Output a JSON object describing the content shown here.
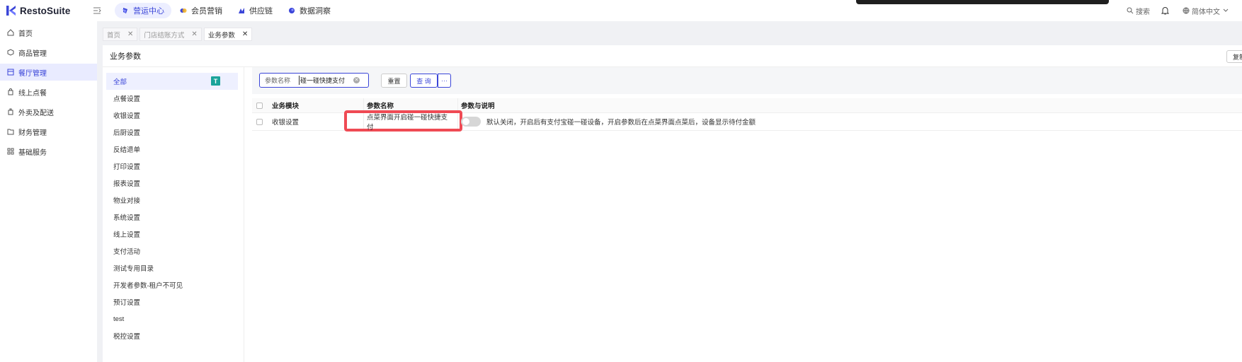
{
  "app": {
    "name": "RestoSuite"
  },
  "topnav": [
    {
      "label": "营运中心",
      "active": true
    },
    {
      "label": "会员营销",
      "active": false
    },
    {
      "label": "供应链",
      "active": false
    },
    {
      "label": "数据洞察",
      "active": false
    }
  ],
  "topright": {
    "search": "搜索",
    "language": "简体中文"
  },
  "sidebar": [
    {
      "label": "首页",
      "icon": "home-icon"
    },
    {
      "label": "商品管理",
      "icon": "box-icon"
    },
    {
      "label": "餐厅管理",
      "icon": "store-icon",
      "active": true
    },
    {
      "label": "线上点餐",
      "icon": "bag-icon"
    },
    {
      "label": "外卖及配送",
      "icon": "delivery-icon"
    },
    {
      "label": "财务管理",
      "icon": "folder-icon"
    },
    {
      "label": "基础服务",
      "icon": "grid-icon"
    }
  ],
  "tabs": [
    {
      "label": "首页"
    },
    {
      "label": "门店结账方式"
    },
    {
      "label": "业务参数",
      "active": true
    }
  ],
  "page": {
    "title": "业务参数",
    "copy_button": "复制"
  },
  "categories": [
    "全部",
    "点餐设置",
    "收银设置",
    "后厨设置",
    "反结退单",
    "打印设置",
    "报表设置",
    "物业对接",
    "系统设置",
    "线上设置",
    "支付活动",
    "测试专用目录",
    "开发者参数-租户不可见",
    "预订设置",
    "test",
    "税控设置"
  ],
  "category_badge": "T",
  "search": {
    "label": "参数名称",
    "value": "碰一碰快捷支付",
    "reset": "重置",
    "query": "查 询",
    "more": "···"
  },
  "table": {
    "headers": [
      "业务模块",
      "参数名称",
      "参数与说明"
    ],
    "rows": [
      {
        "module": "收银设置",
        "name": "点菜界面开启碰一碰快捷支付",
        "enabled": false,
        "description": "默认关闭，开启后有支付宝碰一碰设备，开启参数后在点菜界面点菜后，设备显示待付金额"
      }
    ]
  },
  "colors": {
    "accent": "#3a45d8",
    "highlight": "#ef4a54",
    "badge": "#1aa39a"
  }
}
